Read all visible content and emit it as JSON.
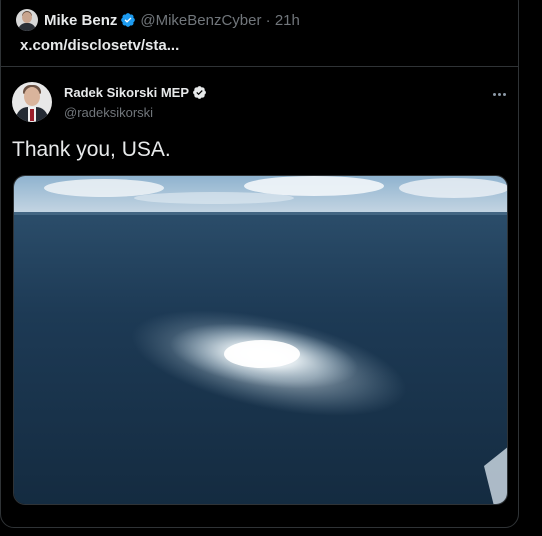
{
  "outer_tweet": {
    "author_name": "Mike Benz",
    "author_handle": "@MikeBenzCyber",
    "time_sep": "·",
    "timestamp": "21h",
    "link_text": "x.com/disclosetv/sta..."
  },
  "quoted_tweet": {
    "author_name": "Radek Sikorski MEP",
    "author_handle": "@radeksikorski",
    "text": "Thank you, USA.",
    "image_description_icon": "ocean-gas-leak-photo"
  },
  "colors": {
    "background": "#000000",
    "text_primary": "#e7e9ea",
    "text_secondary": "#71767b",
    "border": "#2f3336",
    "verified": "#1d9bf0"
  }
}
